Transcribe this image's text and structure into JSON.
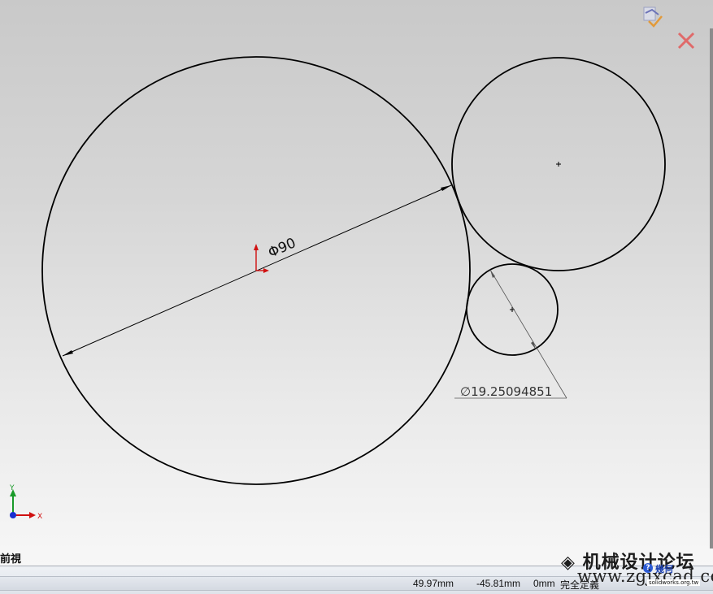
{
  "sketch": {
    "dimension_large": "Φ90",
    "dimension_small": "∅19.25094851",
    "triad": {
      "y_label": "Y",
      "x_label": "X"
    }
  },
  "view": {
    "name": "前視"
  },
  "status": {
    "x": "49.97mm",
    "y": "-45.81mm",
    "z": "0mm",
    "state": "完全定義"
  },
  "watermark": {
    "title": "机械设计论坛",
    "url": "www.zgjxcad.com",
    "badge_text": "solidworks.org.tw",
    "question": "幾何"
  },
  "colors": {
    "sketch_line": "#000000",
    "origin_red": "#d01010",
    "triad_green": "#1a9a2a",
    "triad_blue": "#1a2fd0"
  },
  "icons": [
    "confirm-corner-icon",
    "cancel-corner-icon",
    "sketch-origin-icon",
    "axis-triad-icon",
    "help-icon",
    "forum-logo-icon"
  ]
}
